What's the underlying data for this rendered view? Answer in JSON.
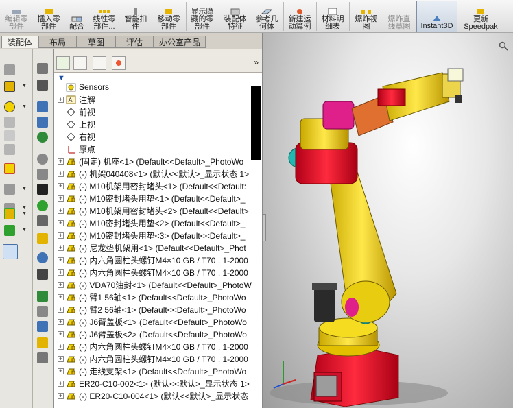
{
  "ribbon": {
    "buttons": [
      {
        "label": "编辑零\n部件",
        "icon": "edit-part-icon"
      },
      {
        "label": "插入零\n部件",
        "icon": "insert-component-icon"
      },
      {
        "label": "配合",
        "icon": "mate-icon"
      },
      {
        "label": "线性零\n部件...",
        "icon": "linear-pattern-icon"
      },
      {
        "label": "智能扣\n件",
        "icon": "smart-fasteners-icon"
      },
      {
        "label": "移动零\n部件",
        "icon": "move-component-icon"
      },
      {
        "label": "显示隐\n藏的零\n部件",
        "icon": "show-hidden-icon"
      },
      {
        "label": "装配体\n特征",
        "icon": "assembly-features-icon"
      },
      {
        "label": "参考几\n何体",
        "icon": "reference-geometry-icon"
      },
      {
        "label": "新建运\n动算例",
        "icon": "new-motion-study-icon"
      },
      {
        "label": "材料明\n细表",
        "icon": "bom-icon"
      },
      {
        "label": "爆炸视\n图",
        "icon": "exploded-view-icon"
      },
      {
        "label": "爆炸直\n线草图",
        "icon": "explode-line-sketch-icon"
      },
      {
        "label": "Instant3D",
        "icon": "instant3d-icon"
      },
      {
        "label": "更新\nSpeedpak",
        "icon": "speedpak-icon"
      }
    ]
  },
  "tabs": [
    "装配体",
    "布局",
    "草图",
    "评估",
    "办公室产品"
  ],
  "tree": {
    "collapse_glyph": "»",
    "filter_glyph": "▼",
    "rows": [
      {
        "label": "Sensors",
        "icon": "sensors-icon",
        "expandable": false
      },
      {
        "label": "注解",
        "icon": "annotations-icon",
        "expandable": true
      },
      {
        "label": "前视",
        "icon": "plane-icon",
        "expandable": false
      },
      {
        "label": "上视",
        "icon": "plane-icon",
        "expandable": false
      },
      {
        "label": "右视",
        "icon": "plane-icon",
        "expandable": false
      },
      {
        "label": "原点",
        "icon": "origin-icon",
        "expandable": false
      },
      {
        "label": "(固定) 机座<1> (Default<<Default>_PhotoWo",
        "icon": "part-icon",
        "expandable": true
      },
      {
        "label": "(-) 机架040408<1> (默认<<默认>_显示状态 1>",
        "icon": "part-icon",
        "expandable": true
      },
      {
        "label": "(-) M10机架用密封堵头<1> (Default<<Default:",
        "icon": "part-icon",
        "expandable": true
      },
      {
        "label": "(-) M10密封堵头用垫<1> (Default<<Default>_",
        "icon": "part-icon",
        "expandable": true
      },
      {
        "label": "(-) M10机架用密封堵头<2> (Default<<Default>",
        "icon": "part-icon",
        "expandable": true
      },
      {
        "label": "(-) M10密封堵头用垫<2> (Default<<Default>_",
        "icon": "part-icon",
        "expandable": true
      },
      {
        "label": "(-) M10密封堵头用垫<3> (Default<<Default>_",
        "icon": "part-icon",
        "expandable": true
      },
      {
        "label": "(-) 尼龙垫机架用<1> (Default<<Default>_Phot",
        "icon": "part-icon",
        "expandable": true
      },
      {
        "label": "(-) 内六角圆柱头螺钉M4×10 GB / T70 . 1-2000",
        "icon": "part-icon",
        "expandable": true
      },
      {
        "label": "(-) 内六角圆柱头螺钉M4×10 GB / T70 . 1-2000",
        "icon": "part-icon",
        "expandable": true
      },
      {
        "label": "(-) VDA70油封<1> (Default<<Default>_PhotoW",
        "icon": "part-icon",
        "expandable": true
      },
      {
        "label": "(-) 臂1 56轴<1> (Default<<Default>_PhotoWo",
        "icon": "part-icon",
        "expandable": true
      },
      {
        "label": "(-) 臂2 56轴<1> (Default<<Default>_PhotoWo",
        "icon": "part-icon",
        "expandable": true
      },
      {
        "label": "(-) J6臂盖板<1> (Default<<Default>_PhotoWo",
        "icon": "part-icon",
        "expandable": true
      },
      {
        "label": "(-) J6臂盖板<2> (Default<<Default>_PhotoWo",
        "icon": "part-icon",
        "expandable": true
      },
      {
        "label": "(-) 内六角圆柱头螺钉M4×10 GB / T70 . 1-2000",
        "icon": "part-icon",
        "expandable": true
      },
      {
        "label": "(-) 内六角圆柱头螺钉M4×10 GB / T70 . 1-2000",
        "icon": "part-icon",
        "expandable": true
      },
      {
        "label": "(-) 走线支架<1> (Default<<Default>_PhotoWo",
        "icon": "part-icon",
        "expandable": true
      },
      {
        "label": "ER20-C10-002<1> (默认<<默认>_显示状态 1>",
        "icon": "part-icon",
        "expandable": true
      },
      {
        "label": "(-) ER20-C10-004<1> (默认<<默认>_显示状态",
        "icon": "part-icon",
        "expandable": true
      }
    ]
  },
  "colors": {
    "robot_yellow": "#f2d200",
    "robot_red": "#e0102a",
    "robot_magenta": "#e0208a",
    "robot_orange": "#e07030",
    "robot_teal": "#20b8b0",
    "motor_dark": "#2a2a2a"
  }
}
